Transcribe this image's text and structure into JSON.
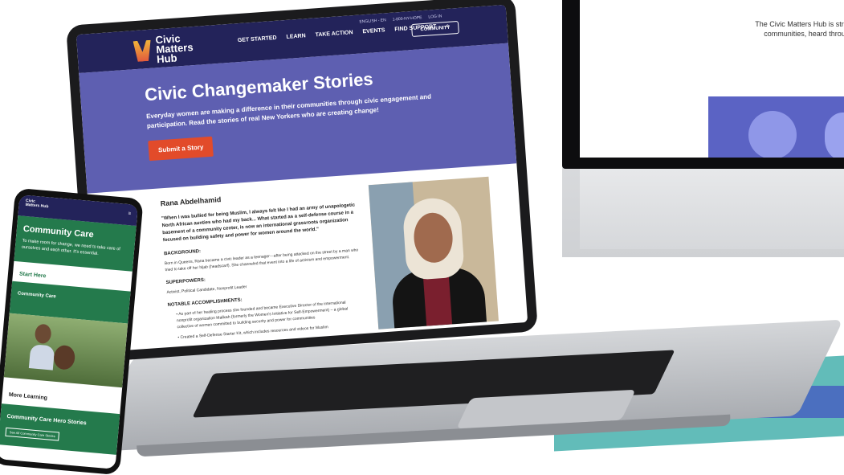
{
  "desktop": {
    "intro_text": "The Civic Matters Hub is stronger communities, heard through"
  },
  "laptop": {
    "brand": "Civic Matters Hub",
    "nav": {
      "links": [
        "GET STARTED",
        "LEARN",
        "TAKE ACTION",
        "EVENTS",
        "FIND SUPPORT"
      ],
      "top_links": [
        "ENGLISH - EN",
        "1-800-NY-HOPE",
        "LOG IN"
      ],
      "community_label": "COMMUNITY"
    },
    "hero": {
      "title": "Civic Changemaker Stories",
      "subtitle": "Everyday women are making a difference in their communities through civic engagement and participation. Read the stories of real New Yorkers who are creating change!",
      "button": "Submit a Story"
    },
    "story": {
      "name": "Rana Abdelhamid",
      "quote": "\"When I was bullied for being Muslim, I always felt like I had an army of unapologetic North African aunties who had my back... What started as a self-defense course in a basement of a community center, is now an international grassroots organization focused on building safety and power for women around the world.\"",
      "background_heading": "BACKGROUND:",
      "background_text": "Born in Queens, Rana became a civic leader as a teenager—after being attacked on the street by a man who tried to take off her hijab (headscarf). She channeled that event into a life of activism and empowerment.",
      "superpowers_heading": "SUPERPOWERS:",
      "superpowers_text": "Activist, Political Candidate, Nonprofit Leader",
      "accomplishments_heading": "NOTABLE ACCOMPLISHMENTS:",
      "accomplishments": [
        "As part of her healing process she founded and became Executive Director of the international nonprofit organization Malikah (formerly the Women's Initiative for Self-Empowerment) – a global collective of women committed to building security and power for communities",
        "Created a Self-Defense Starter Kit, which includes resources and videos for Muslim"
      ]
    }
  },
  "phone": {
    "brand": "Civic Matters Hub",
    "hero_title": "Community Care",
    "hero_text": "To make room for change, we need to take care of ourselves and each other. It's essential.",
    "start_here": "Start Here",
    "community_care_label": "Community Care",
    "more_learning": "More Learning",
    "hero_stories_title": "Community Care Hero Stories",
    "see_all_button": "See All Community Care Stories"
  },
  "colors": {
    "navy": "#23235a",
    "hero_purple": "#5e5fb1",
    "accent_orange": "#e24b2a",
    "phone_green": "#247a4c",
    "teal": "#62bcb9"
  }
}
